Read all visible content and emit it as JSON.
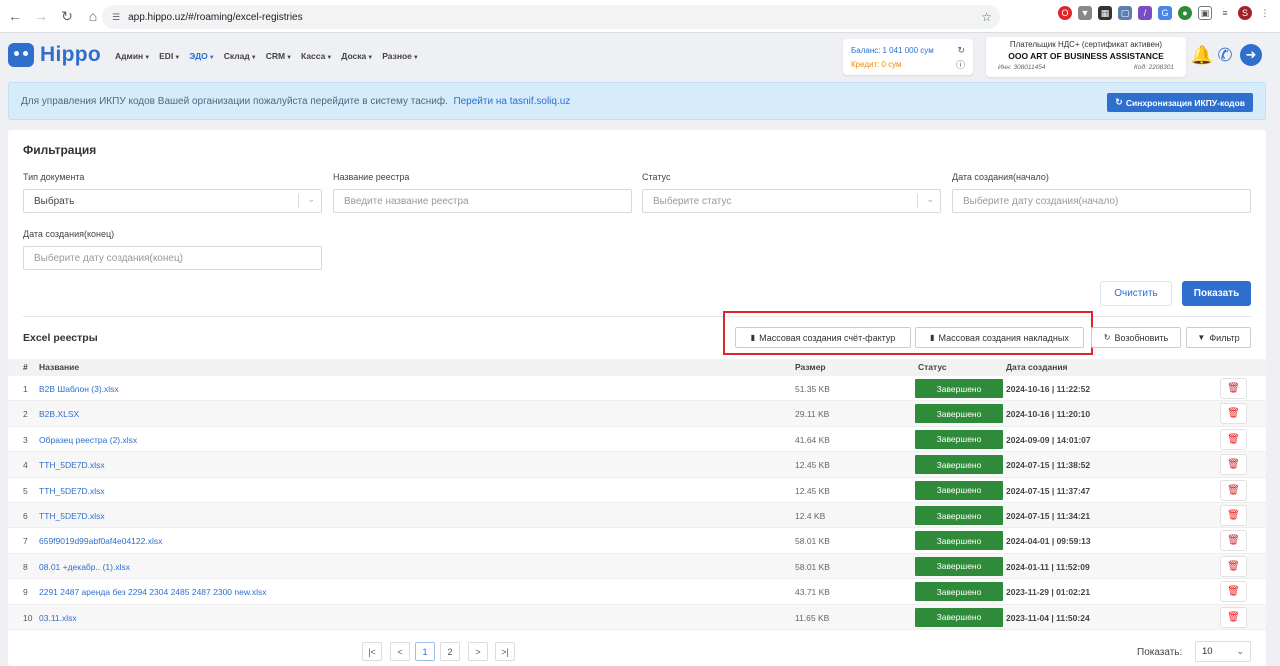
{
  "browser": {
    "url": "app.hippo.uz/#/roaming/excel-registries"
  },
  "header": {
    "logo": "Hippo",
    "menu": [
      {
        "label": "Админ",
        "active": false
      },
      {
        "label": "EDI",
        "active": false
      },
      {
        "label": "ЭДО",
        "active": true
      },
      {
        "label": "Склад",
        "active": false
      },
      {
        "label": "CRM",
        "active": false
      },
      {
        "label": "Касса",
        "active": false
      },
      {
        "label": "Доска",
        "active": false
      },
      {
        "label": "Разное",
        "active": false
      }
    ],
    "balance_label": "Баланс:",
    "balance_value": "1 041 000 сум",
    "credit_label": "Кредит:",
    "credit_value": "0 сум",
    "company_status": "Плательщик НДС+ (сертификат активен)",
    "company_name": "OOO ART OF BUSINESS ASSISTANCE",
    "company_inn": "Инн: 308011454",
    "company_code": "Код: 2208301"
  },
  "banner": {
    "text": "Для управления ИКПУ кодов Вашей организации пожалуйста перейдите в систему тасниф.",
    "link_prefix": "Перейти на",
    "link": "tasnif.soliq.uz",
    "sync_button": "Синхронизация ИКПУ-кодов"
  },
  "filter": {
    "title": "Фильтрация",
    "doc_type_label": "Тип документа",
    "doc_type_value": "Выбрать",
    "registry_name_label": "Название реестра",
    "registry_name_placeholder": "Введите название реестра",
    "status_label": "Статус",
    "status_placeholder": "Выберите статус",
    "date_start_label": "Дата создания(начало)",
    "date_start_placeholder": "Выберите дату создания(начало)",
    "date_end_label": "Дата создания(конец)",
    "date_end_placeholder": "Выберите дату создания(конец)",
    "clear_button": "Очистить",
    "show_button": "Показать"
  },
  "list": {
    "title": "Excel реестры",
    "mass_invoice_button": "Массовая создания счёт-фактур",
    "mass_waybill_button": "Массовая создания накладных",
    "refresh_button": "Возобновить",
    "filter_button": "Фильтр",
    "columns": {
      "num": "#",
      "name": "Название",
      "size": "Размер",
      "status": "Статус",
      "date": "Дата создания"
    },
    "rows": [
      {
        "num": "1",
        "name": "B2B Шаблон (3).xlsx",
        "size": "51.35 KB",
        "status": "Завершено",
        "date": "2024-10-16 | 11:22:52"
      },
      {
        "num": "2",
        "name": "B2B.XLSX",
        "size": "29.11 KB",
        "status": "Завершено",
        "date": "2024-10-16 | 11:20:10"
      },
      {
        "num": "3",
        "name": "Образец реестра (2).xlsx",
        "size": "41.64 KB",
        "status": "Завершено",
        "date": "2024-09-09 | 14:01:07"
      },
      {
        "num": "4",
        "name": "TTH_5DE7D.xlsx",
        "size": "12.45 KB",
        "status": "Завершено",
        "date": "2024-07-15 | 11:38:52"
      },
      {
        "num": "5",
        "name": "TTH_5DE7D.xlsx",
        "size": "12.45 KB",
        "status": "Завершено",
        "date": "2024-07-15 | 11:37:47"
      },
      {
        "num": "6",
        "name": "TTH_5DE7D.xlsx",
        "size": "12.4 KB",
        "status": "Завершено",
        "date": "2024-07-15 | 11:34:21"
      },
      {
        "num": "7",
        "name": "659f9019d99abf0af4e04122.xlsx",
        "size": "58.01 KB",
        "status": "Завершено",
        "date": "2024-04-01 | 09:59:13"
      },
      {
        "num": "8",
        "name": "08.01 +декабр.. (1).xlsx",
        "size": "58.01 KB",
        "status": "Завершено",
        "date": "2024-01-11 | 11:52:09"
      },
      {
        "num": "9",
        "name": "2291 2487 аренда без 2294 2304 2485 2487 2300 new.xlsx",
        "size": "43.71 KB",
        "status": "Завершено",
        "date": "2023-11-29 | 01:02:21"
      },
      {
        "num": "10",
        "name": "03.11.xlsx",
        "size": "11.65 KB",
        "status": "Завершено",
        "date": "2023-11-04 | 11:50:24"
      }
    ]
  },
  "pagination": {
    "pages": [
      "1",
      "2"
    ],
    "active_page": "1",
    "show_label": "Показать:",
    "page_size": "10"
  }
}
